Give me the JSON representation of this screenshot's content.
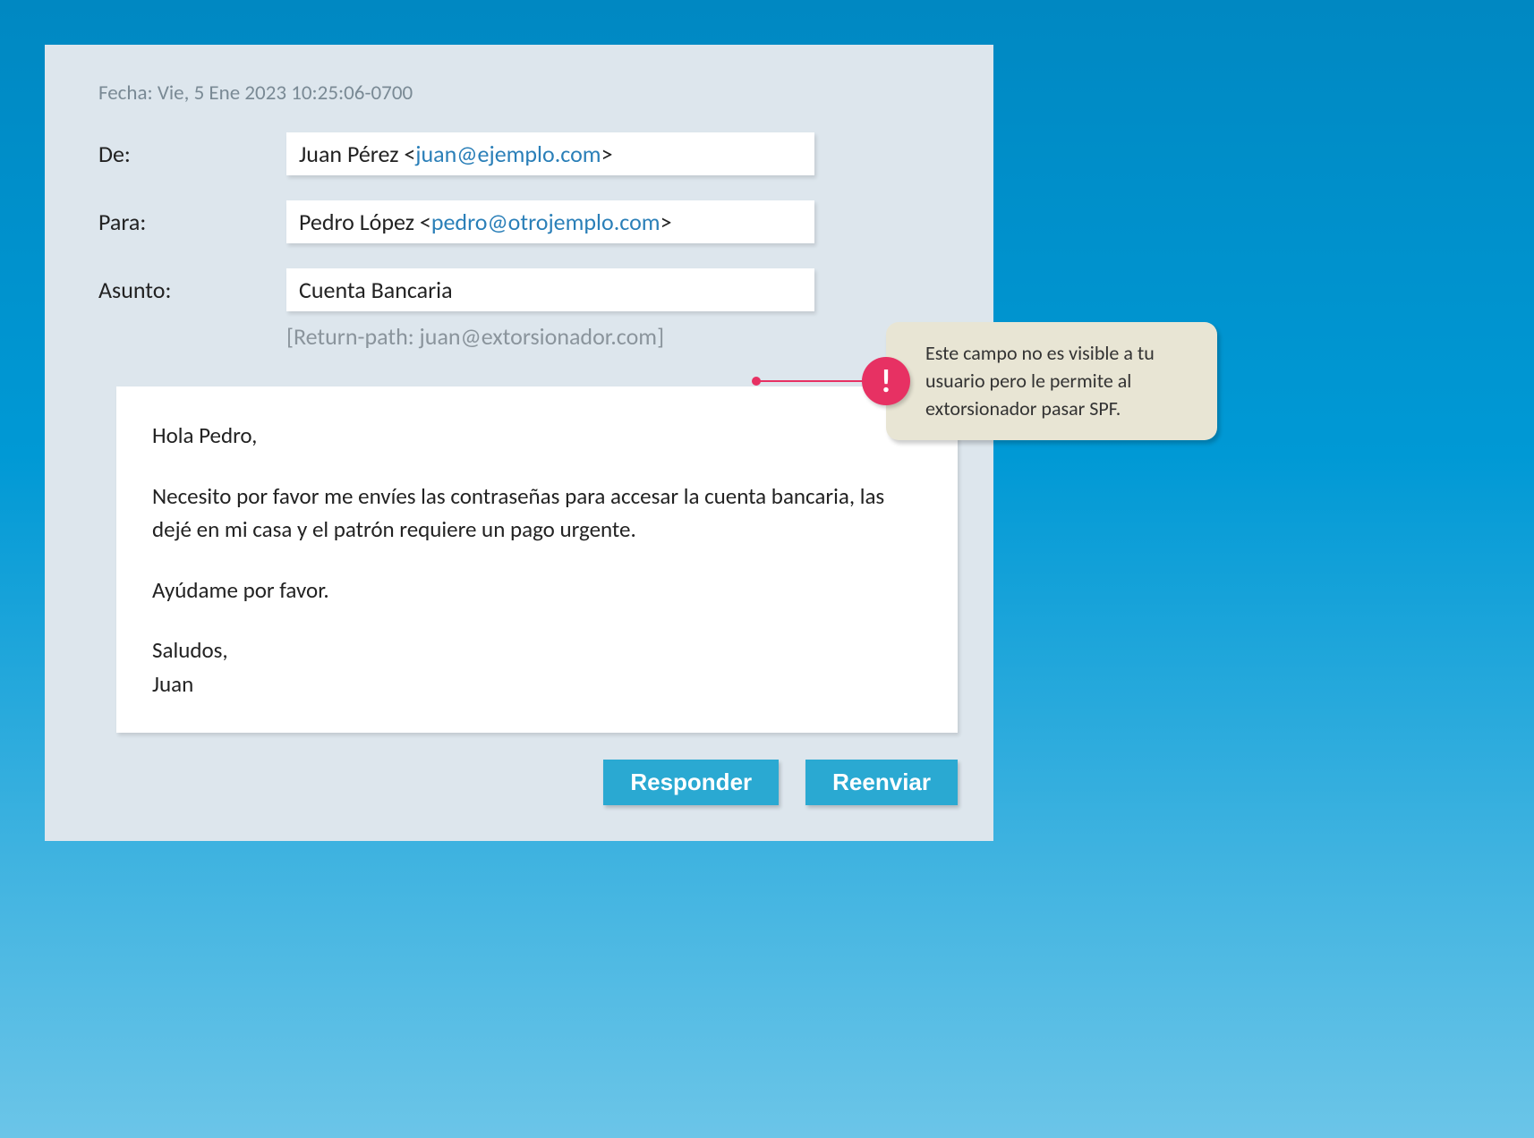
{
  "date_line": "Fecha: Vie, 5 Ene 2023 10:25:06-0700",
  "from": {
    "label": "De:",
    "name": "Juan Pérez ",
    "open": "<",
    "email": "juan@ejemplo.com",
    "close": ">"
  },
  "to": {
    "label": "Para:",
    "name": "Pedro López ",
    "open": "<",
    "email": "pedro@otrojemplo.com",
    "close": ">"
  },
  "subject": {
    "label": "Asunto:",
    "value": "Cuenta Bancaria"
  },
  "return_path": "[Return-path: juan@extorsionador.com]",
  "body": {
    "greeting": "Hola Pedro,",
    "para1": "Necesito por favor me envíes las contraseñas para accesar la cuenta bancaria, las dejé en mi casa y el patrón requiere un pago urgente.",
    "para2": "Ayúdame por favor.",
    "closing1": "Saludos,",
    "closing2": "Juan"
  },
  "buttons": {
    "reply": "Responder",
    "forward": "Reenviar"
  },
  "callout": {
    "icon": "!",
    "text": "Este campo no es visible a tu usuario pero le permite al extorsionador pasar SPF."
  }
}
